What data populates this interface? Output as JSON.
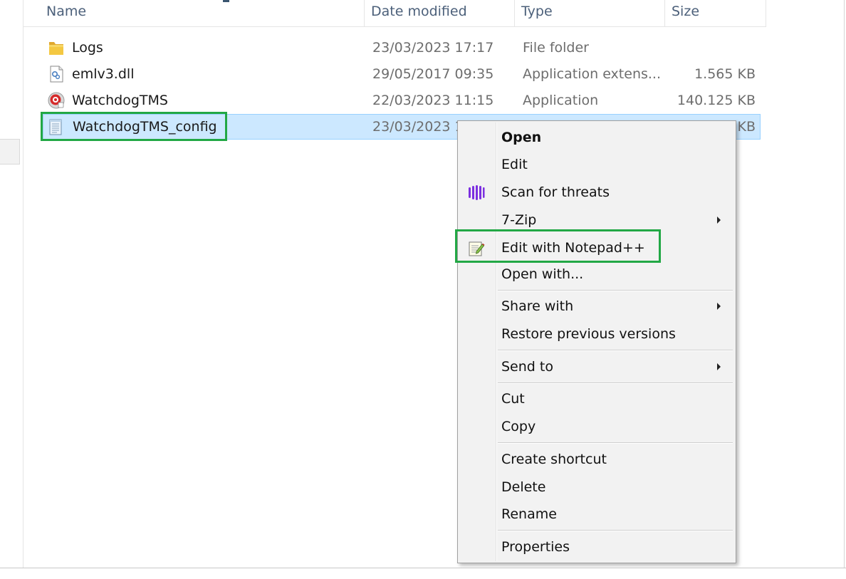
{
  "columns": {
    "name": "Name",
    "date_modified": "Date modified",
    "type": "Type",
    "size": "Size"
  },
  "files": [
    {
      "name": "Logs",
      "date": "23/03/2023 17:17",
      "type": "File folder",
      "size": "",
      "icon": "folder-icon"
    },
    {
      "name": "emlv3.dll",
      "date": "29/05/2017 09:35",
      "type": "Application extens...",
      "size": "1.565 KB",
      "icon": "dll-file-icon"
    },
    {
      "name": "WatchdogTMS",
      "date": "22/03/2023 11:15",
      "type": "Application",
      "size": "140.125 KB",
      "icon": "application-icon"
    },
    {
      "name": "WatchdogTMS_config",
      "date": "23/03/2023 1",
      "type": "",
      "size": "KB",
      "icon": "config-file-icon",
      "selected": true
    }
  ],
  "context_menu": {
    "open": "Open",
    "edit": "Edit",
    "scan_for_threats": "Scan for threats",
    "seven_zip": "7-Zip",
    "edit_with_notepadpp": "Edit with Notepad++",
    "open_with": "Open with...",
    "share_with": "Share with",
    "restore_previous_versions": "Restore previous versions",
    "send_to": "Send to",
    "cut": "Cut",
    "copy": "Copy",
    "create_shortcut": "Create shortcut",
    "delete": "Delete",
    "rename": "Rename",
    "properties": "Properties"
  },
  "colors": {
    "selection_bg": "#cce8ff",
    "selection_border": "#99d1ff",
    "annotation_green": "#22a845",
    "header_text": "#4c607a",
    "menu_bg": "#f2f2f2"
  }
}
